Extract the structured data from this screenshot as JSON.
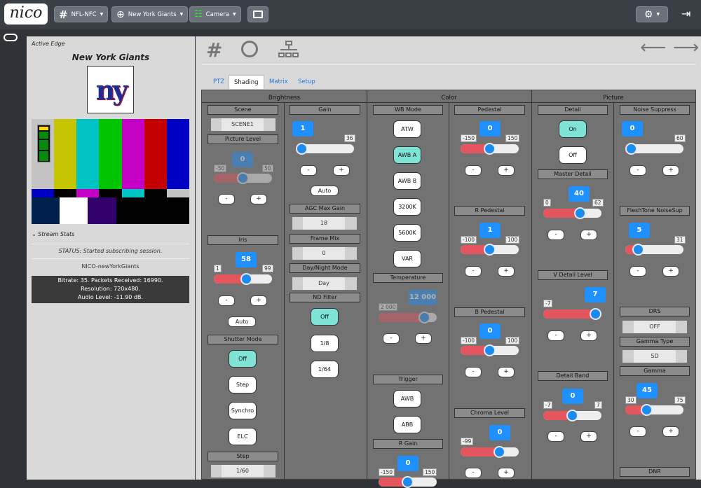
{
  "nav": {
    "logo": "nico",
    "league": "NFL-NFC",
    "team": "New York Giants",
    "camera": "Camera"
  },
  "left": {
    "header": "Active Edge",
    "team_title": "New York Giants",
    "team_logo": "ny",
    "stream_stats": "Stream Stats",
    "status": "STATUS: Started subscribing session.",
    "session": "NICO-newYorkGiants",
    "bitrate": "Bitrate: 35.  Packets Received: 16990.",
    "resolution": "Resolution: 720x480.",
    "audio": "Audio Level: -11.90 dB."
  },
  "tabs": [
    "PTZ",
    "Shading",
    "Matrix",
    "Setup"
  ],
  "sections": {
    "brightness": "Brightness",
    "color": "Color",
    "picture": "Picture"
  },
  "labels": {
    "scene": "Scene",
    "scene_val": "SCENE1",
    "picture_level": "Picture Level",
    "gain": "Gain",
    "iris": "Iris",
    "agc": "AGC Max Gain",
    "agc_val": "18",
    "frame_mix": "Frame Mix",
    "frame_mix_val": "0",
    "day_night": "Day/Night Mode",
    "day_night_val": "Day",
    "nd_filter": "ND Filter",
    "shutter_mode": "Shutter Mode",
    "step": "Step",
    "step_val": "1/60",
    "wb_mode": "WB Mode",
    "temperature": "Temperature",
    "trigger": "Trigger",
    "r_gain": "R Gain",
    "pedestal": "Pedestal",
    "r_pedestal": "R Pedestal",
    "b_pedestal": "B Pedestal",
    "chroma_level": "Chroma Level",
    "detail": "Detail",
    "master_detail": "Master Detail",
    "v_detail": "V Detail Level",
    "detail_band": "Detail Band",
    "noise_suppress": "Noise Suppress",
    "fleshtone": "FleshTone NoiseSup",
    "drs": "DRS",
    "drs_val": "OFF",
    "gamma_type": "Gamma Type",
    "gamma_type_val": "SD",
    "gamma": "Gamma",
    "dnr": "DNR"
  },
  "buttons": {
    "minus": "-",
    "plus": "+",
    "auto": "Auto",
    "off": "Off",
    "on": "On",
    "step": "Step",
    "synchro": "Synchro",
    "elc": "ELC",
    "nd1": "1/8",
    "nd2": "1/64",
    "atw": "ATW",
    "awba": "AWB A",
    "awbb": "AWB B",
    "k3200": "3200K",
    "k5600": "5600K",
    "var": "VAR",
    "awb": "AWB",
    "abb": "ABB"
  },
  "sliders": {
    "picture_level": {
      "value": "0",
      "min": "-50",
      "max": "50"
    },
    "gain": {
      "value": "1",
      "max": "36"
    },
    "iris": {
      "value": "58",
      "min": "1",
      "max": "99"
    },
    "temperature": {
      "value": "12 000",
      "min": "2 000"
    },
    "r_gain": {
      "value": "0",
      "min": "-150",
      "max": "150"
    },
    "pedestal": {
      "value": "0",
      "min": "-150",
      "max": "150"
    },
    "r_pedestal": {
      "value": "1",
      "min": "-100",
      "max": "100"
    },
    "b_pedestal": {
      "value": "0",
      "min": "-100",
      "max": "100"
    },
    "chroma_level": {
      "value": "0",
      "min": "-99"
    },
    "master_detail": {
      "value": "40",
      "min": "0",
      "max": "62"
    },
    "v_detail": {
      "value": "7",
      "min": "-7"
    },
    "detail_band": {
      "value": "0",
      "min": "-7",
      "max": "7"
    },
    "noise_suppress": {
      "value": "0",
      "max": "60"
    },
    "fleshtone": {
      "value": "5",
      "max": "31"
    },
    "gamma": {
      "value": "45",
      "min": "30",
      "max": "75"
    }
  }
}
